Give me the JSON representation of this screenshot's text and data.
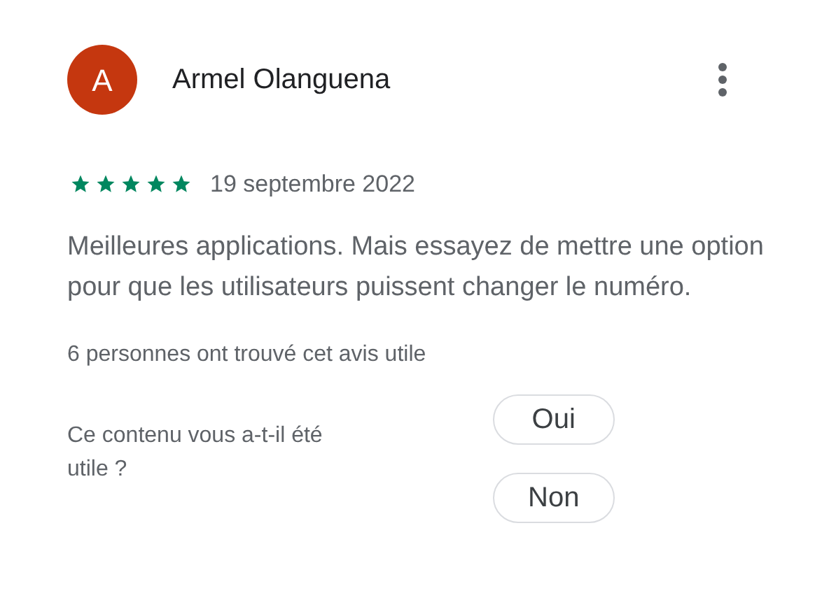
{
  "review": {
    "avatar_letter": "A",
    "author": "Armel Olanguena",
    "stars": 5,
    "date": "19 septembre 2022",
    "text": "Meilleures applications. Mais essayez de mettre une option pour que les utilisateurs puissent changer le numéro.",
    "helpful_count": "6 personnes ont trouvé cet avis utile"
  },
  "feedback": {
    "question": "Ce contenu vous a-t-il été utile ?",
    "buttons": [
      "Oui",
      "Non"
    ]
  }
}
